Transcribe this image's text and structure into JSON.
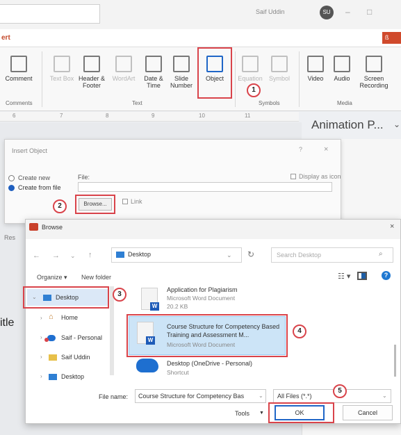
{
  "titlebar": {
    "user_name": "Saif Uddin",
    "avatar_initials": "SU",
    "minimize_glyph": "–",
    "restore_glyph": "□"
  },
  "ribbon_tabs": {
    "partial_tab": "ert",
    "share_label": "ß"
  },
  "ribbon": {
    "buttons": [
      {
        "label": "Comment",
        "icon": "comment-icon"
      },
      {
        "label": "Text Box",
        "icon": "text-box-icon",
        "disabled": true
      },
      {
        "label": "Header & Footer",
        "icon": "header-footer-icon"
      },
      {
        "label": "WordArt",
        "icon": "wordart-icon",
        "disabled": true
      },
      {
        "label": "Date & Time",
        "icon": "date-time-icon"
      },
      {
        "label": "Slide Number",
        "icon": "slide-number-icon"
      },
      {
        "label": "Object",
        "icon": "object-icon"
      },
      {
        "label": "Equation",
        "icon": "equation-icon",
        "disabled": true
      },
      {
        "label": "Symbol",
        "icon": "symbol-icon",
        "disabled": true
      },
      {
        "label": "Video",
        "icon": "video-icon"
      },
      {
        "label": "Audio",
        "icon": "audio-icon"
      },
      {
        "label": "Screen Recording",
        "icon": "screen-recording-icon"
      }
    ],
    "groups": [
      "Comments",
      "Text",
      "Symbols",
      "Media"
    ]
  },
  "ruler": {
    "ticks": [
      "6",
      "7",
      "8",
      "9",
      "10",
      "11"
    ]
  },
  "animation_pane": {
    "title": "Animation P..."
  },
  "slide": {
    "title_fragment": "itle"
  },
  "insert_object": {
    "title": "Insert Object",
    "help": "?",
    "close": "×",
    "option_create_new": "Create new",
    "option_create_from_file": "Create from file",
    "file_label": "File:",
    "browse_label": "Browse...",
    "link_label": "Link",
    "display_as_icon": "Display as icon",
    "result_fragment": "Res"
  },
  "browse": {
    "title": "Browse",
    "close": "×",
    "address": "Desktop",
    "search_placeholder": "Search Desktop",
    "organize": "Organize ▾",
    "new_folder": "New folder",
    "nav": [
      {
        "label": "Desktop",
        "selected": true,
        "icon": "desktop-folder-icon"
      },
      {
        "label": "Home",
        "icon": "home-icon"
      },
      {
        "label": "Saif - Personal",
        "icon": "onedrive-icon"
      },
      {
        "label": "Saif Uddin",
        "icon": "user-folder-icon"
      },
      {
        "label": "Desktop",
        "icon": "desktop-folder-icon"
      }
    ],
    "files": [
      {
        "name": "Application for Plagiarism",
        "type": "Microsoft Word Document",
        "size": "20.2 KB"
      },
      {
        "name": "Course Structure for Competency Based Training and Assessment M...",
        "type": "Microsoft Word Document",
        "selected": true
      },
      {
        "name": "Desktop (OneDrive - Personal)",
        "type": "Shortcut"
      }
    ],
    "file_name_label": "File name:",
    "file_name_value": "Course Structure for Competency Bas",
    "file_type": "All Files (*.*)",
    "tools": "Tools",
    "ok": "OK",
    "cancel": "Cancel"
  },
  "steps": [
    "1",
    "2",
    "3",
    "4",
    "5"
  ],
  "colors": {
    "highlight": "#d9434a",
    "accent": "#1f66c7",
    "selection": "#cce4f7"
  }
}
